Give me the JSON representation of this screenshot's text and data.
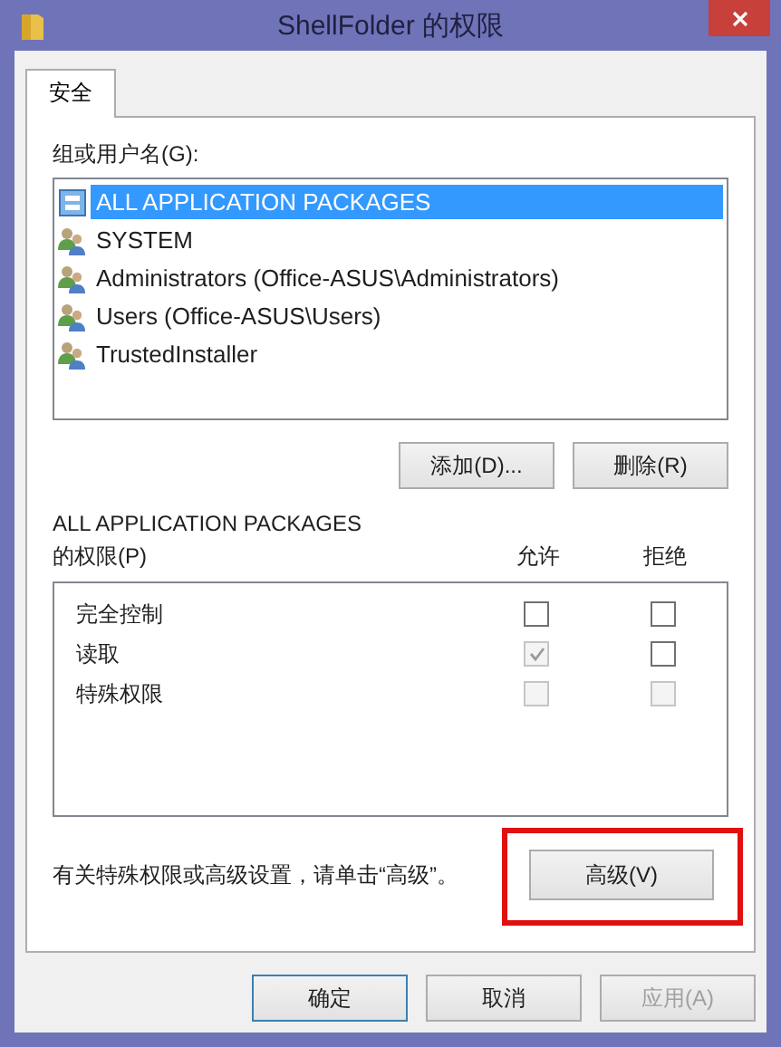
{
  "window": {
    "title": "ShellFolder 的权限"
  },
  "tabs": [
    {
      "label": "安全",
      "selected": true
    }
  ],
  "groups": {
    "label": "组或用户名(G):",
    "items": [
      {
        "name": "ALL APPLICATION PACKAGES",
        "kind": "package",
        "selected": true
      },
      {
        "name": "SYSTEM",
        "kind": "users",
        "selected": false
      },
      {
        "name": "Administrators (Office-ASUS\\Administrators)",
        "kind": "users",
        "selected": false
      },
      {
        "name": "Users (Office-ASUS\\Users)",
        "kind": "users",
        "selected": false
      },
      {
        "name": "TrustedInstaller",
        "kind": "users",
        "selected": false
      }
    ],
    "buttons": [
      "添加(D)...",
      "删除(R)"
    ]
  },
  "permissions": {
    "subject": "ALL APPLICATION PACKAGES",
    "label": "的权限(P)",
    "columns": [
      "允许",
      "拒绝"
    ],
    "rows": [
      {
        "name": "完全控制",
        "allow": {
          "checked": false,
          "disabled": false
        },
        "deny": {
          "checked": false,
          "disabled": false
        }
      },
      {
        "name": "读取",
        "allow": {
          "checked": true,
          "disabled": true
        },
        "deny": {
          "checked": false,
          "disabled": false
        }
      },
      {
        "name": "特殊权限",
        "allow": {
          "checked": false,
          "disabled": true
        },
        "deny": {
          "checked": false,
          "disabled": true
        }
      }
    ]
  },
  "advanced": {
    "text": "有关特殊权限或高级设置，请单击“高级”。",
    "button": "高级(V)",
    "highlighted": true
  },
  "footer": [
    {
      "label": "确定",
      "default": true,
      "disabled": false
    },
    {
      "label": "取消",
      "default": false,
      "disabled": false
    },
    {
      "label": "应用(A)",
      "default": false,
      "disabled": true
    }
  ]
}
